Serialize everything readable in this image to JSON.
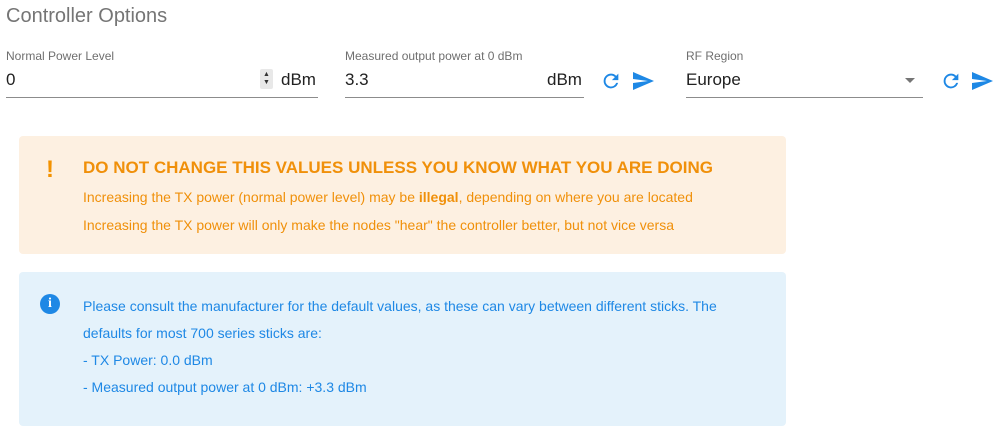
{
  "section_title": "Controller Options",
  "normal_power": {
    "label": "Normal Power Level",
    "value": "0",
    "unit": "dBm"
  },
  "measured_power": {
    "label": "Measured output power at 0 dBm",
    "value": "3.3",
    "unit": "dBm"
  },
  "rf_region": {
    "label": "RF Region",
    "value": "Europe"
  },
  "icons": {
    "refresh": "refresh-icon",
    "send": "send-icon",
    "warning": "exclamation-icon",
    "info": "info-icon"
  },
  "colors": {
    "accent": "#1e88e5",
    "warning": "#f0900a",
    "warning_bg": "#fdf0e1",
    "info_bg": "#e4f2fb"
  },
  "warning": {
    "title": "DO NOT CHANGE THIS VALUES UNLESS YOU KNOW WHAT YOU ARE DOING",
    "line1_before": "Increasing the TX power (normal power level) may be ",
    "line1_bold": "illegal",
    "line1_after": ", depending on where you are located",
    "line2": "Increasing the TX power will only make the nodes \"hear\" the controller better, but not vice versa"
  },
  "info": {
    "line1": "Please consult the manufacturer for the default values, as these can vary between different sticks. The",
    "line2": "defaults for most 700 series sticks are:",
    "line3": "- TX Power: 0.0 dBm",
    "line4": "- Measured output power at 0 dBm: +3.3 dBm"
  }
}
